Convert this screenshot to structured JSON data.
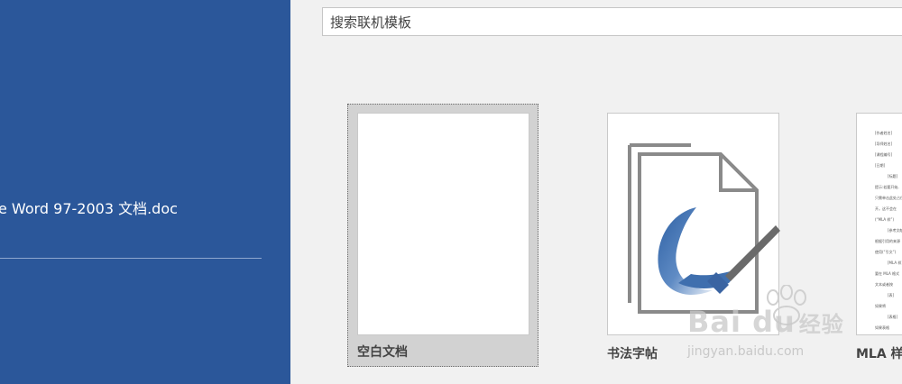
{
  "sidebar": {
    "recent_file": "e Word 97-2003 文档.doc",
    "background_color": "#2b579a"
  },
  "search": {
    "placeholder": "搜索联机模板"
  },
  "templates": [
    {
      "label": "空白文档",
      "selected": true
    },
    {
      "label": "书法字帖",
      "icon": "calligraphy-document-icon"
    },
    {
      "label": "MLA 样"
    }
  ],
  "mla_preview_lines": [
    "[作者姓名]",
    "[导师姓名]",
    "[课程编号]",
    "[日期]",
    "[标题]",
    "提示:若要开始,",
    "只需单击此处占位符",
    "开。这不会在",
    "(“MLA 样”)",
    "[参考文献]",
    "根据引用的来源",
    "使用(“引文”)",
    "[MLA 样]",
    "要在 MLA 格式",
    "文本或者按",
    "[表]",
    "如果将",
    "[表格]",
    "如果表格"
  ],
  "watermark": {
    "brand": "Bai du",
    "brand_cn": "经验",
    "url": "jingyan.baidu.com"
  }
}
